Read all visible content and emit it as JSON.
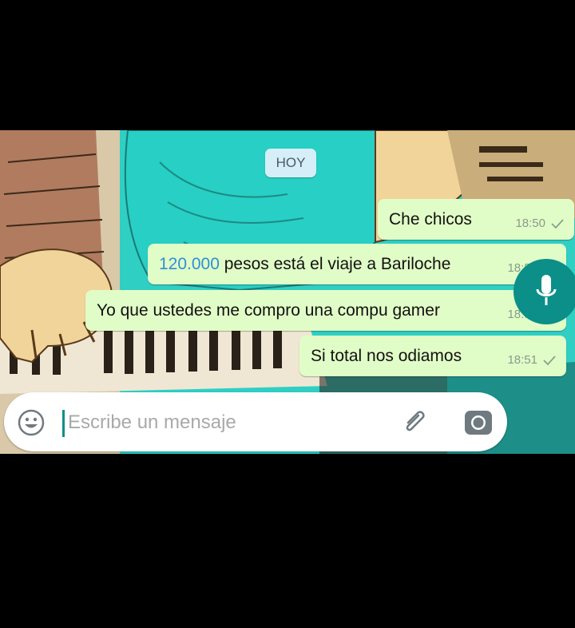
{
  "chat": {
    "date_chip": "HOY",
    "messages": [
      {
        "text": "Che chicos",
        "time": "18:50"
      },
      {
        "number": "120.000",
        "text": " pesos está el viaje a Bariloche",
        "time": "18:51"
      },
      {
        "text": "Yo que ustedes me compro una compu gamer",
        "time": "18:51"
      },
      {
        "text": "Si total nos odiamos",
        "time": "18:51"
      }
    ]
  },
  "composer": {
    "placeholder": "Escribe un mensaje",
    "icons": [
      "emoji-icon",
      "attach-clip-icon",
      "camera-icon",
      "microphone-icon"
    ]
  },
  "colors": {
    "outgoing_bubble": "#e1fdc7",
    "accent": "#0b8f88",
    "link_number": "#2d8fd6"
  }
}
